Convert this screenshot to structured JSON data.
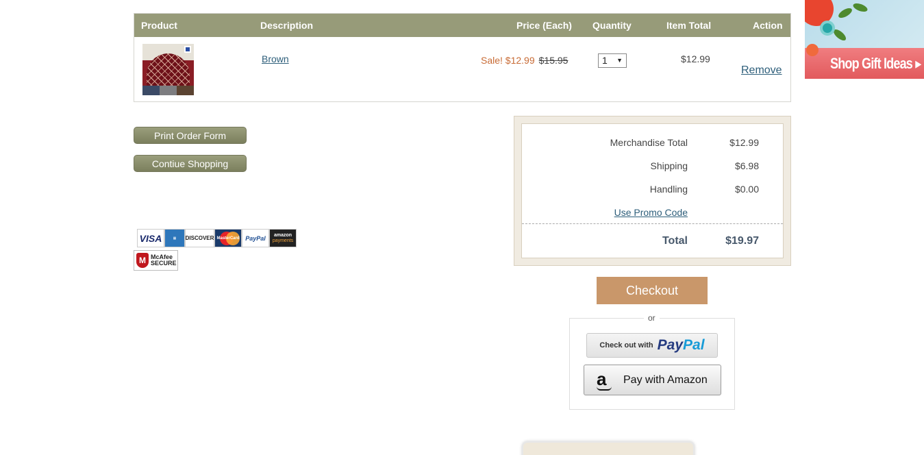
{
  "cart": {
    "headers": {
      "product": "Product",
      "description": "Description",
      "price": "Price (Each)",
      "quantity": "Quantity",
      "item_total": "Item Total",
      "action": "Action"
    },
    "item": {
      "image_icon": "rug-product-image",
      "description": "Brown",
      "sale_price": "Sale! $12.99",
      "original_price": "$15.95",
      "quantity": "1",
      "item_total": "$12.99",
      "remove_label": "Remove"
    }
  },
  "actions": {
    "print_label": "Print Order Form",
    "continue_label": "Contiue Shopping"
  },
  "payment_logos": {
    "visa": "VISA",
    "discover": "DISCOVER",
    "mastercard": "MasterCard",
    "paypal": "PayPal",
    "amazon_top": "amazon",
    "amazon_bottom": "payments",
    "mcafee_line1": "McAfee",
    "mcafee_line2": "SECURE"
  },
  "summary": {
    "merchandise_label": "Merchandise Total",
    "merchandise_value": "$12.99",
    "shipping_label": "Shipping",
    "shipping_value": "$6.98",
    "handling_label": "Handling",
    "handling_value": "$0.00",
    "promo_label": "Use Promo Code",
    "total_label": "Total",
    "total_value": "$19.97"
  },
  "checkout": {
    "checkout_label": "Checkout",
    "or_label": "or",
    "paypal_prefix": "Check out with",
    "paypal_part1": "Pay",
    "paypal_part2": "Pal",
    "amazon_label": "Pay with Amazon"
  },
  "banner": {
    "text": "Shop Gift Ideas ▸"
  },
  "colors": {
    "header_bg": "#979b79",
    "sale": "#c86b35",
    "link": "#2d5e7a",
    "checkout_btn": "#c9976a"
  }
}
